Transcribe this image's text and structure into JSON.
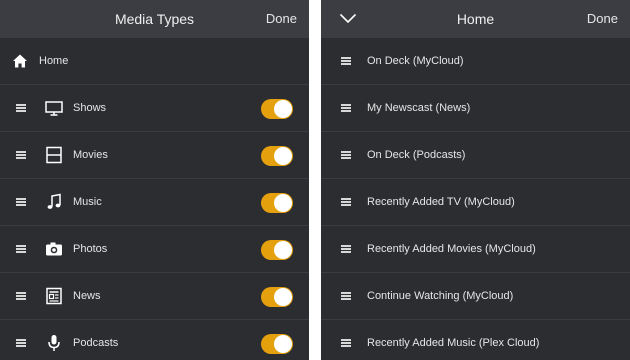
{
  "left": {
    "title": "Media Types",
    "done_label": "Done",
    "home_label": "Home",
    "items": [
      {
        "label": "Shows",
        "icon": "tv-icon",
        "enabled": true
      },
      {
        "label": "Movies",
        "icon": "film-icon",
        "enabled": true
      },
      {
        "label": "Music",
        "icon": "music-note-icon",
        "enabled": true
      },
      {
        "label": "Photos",
        "icon": "camera-icon",
        "enabled": true
      },
      {
        "label": "News",
        "icon": "newspaper-icon",
        "enabled": true
      },
      {
        "label": "Podcasts",
        "icon": "microphone-icon",
        "enabled": true
      }
    ]
  },
  "right": {
    "title": "Home",
    "done_label": "Done",
    "items": [
      {
        "label": "On Deck (MyCloud)"
      },
      {
        "label": "My Newscast (News)"
      },
      {
        "label": "On Deck (Podcasts)"
      },
      {
        "label": "Recently Added TV (MyCloud)"
      },
      {
        "label": "Recently Added Movies (MyCloud)"
      },
      {
        "label": "Continue Watching (MyCloud)"
      },
      {
        "label": "Recently Added Music (Plex Cloud)"
      }
    ]
  },
  "colors": {
    "panel_bg": "#2b2d31",
    "topbar_bg": "#3b3d42",
    "toggle_on": "#e5a00d",
    "divider": "#3a3c41"
  }
}
